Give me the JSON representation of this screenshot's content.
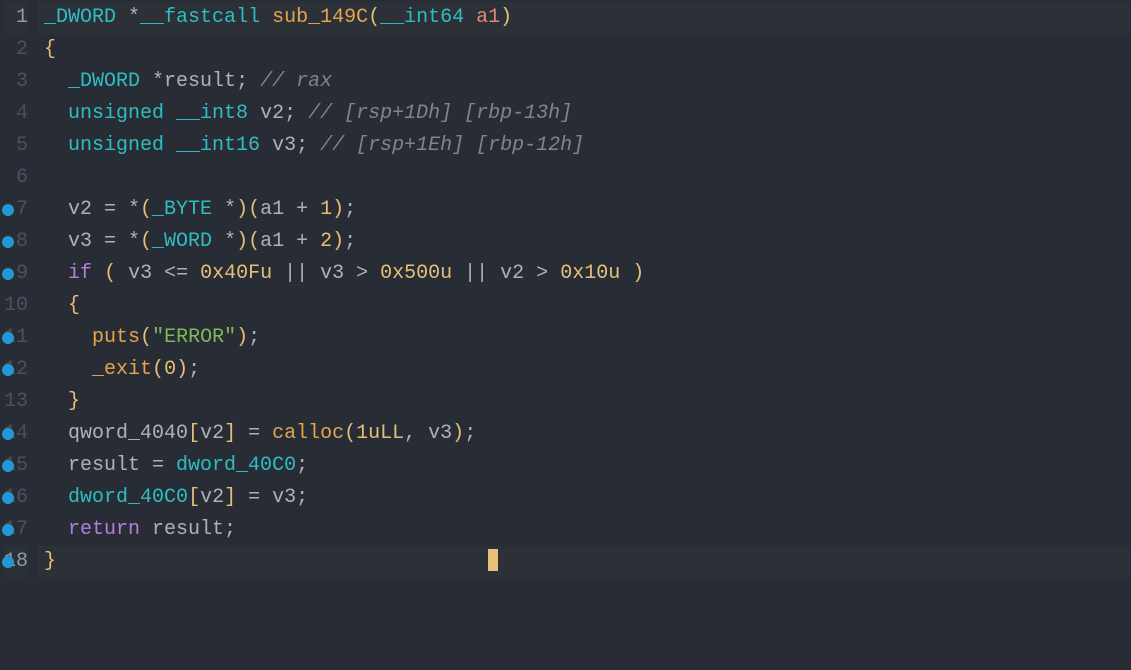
{
  "editor": {
    "cursor_line": 18,
    "lines": [
      {
        "num": 1,
        "bp": false,
        "hl": true,
        "tokens": [
          {
            "c": "tk-type",
            "t": "_DWORD"
          },
          {
            "c": "tk-ident",
            "t": " *"
          },
          {
            "c": "tk-type",
            "t": "__fastcall"
          },
          {
            "c": "tk-ident",
            "t": " "
          },
          {
            "c": "tk-func",
            "t": "sub_149C"
          },
          {
            "c": "tk-paren",
            "t": "("
          },
          {
            "c": "tk-type",
            "t": "__int64"
          },
          {
            "c": "tk-ident",
            "t": " "
          },
          {
            "c": "tk-global",
            "t": "a1"
          },
          {
            "c": "tk-paren",
            "t": ")"
          }
        ]
      },
      {
        "num": 2,
        "bp": false,
        "hl": false,
        "tokens": [
          {
            "c": "tk-paren",
            "t": "{"
          }
        ]
      },
      {
        "num": 3,
        "bp": false,
        "hl": false,
        "tokens": [
          {
            "c": "tk-ident",
            "t": "  "
          },
          {
            "c": "tk-type",
            "t": "_DWORD"
          },
          {
            "c": "tk-ident",
            "t": " *result; "
          },
          {
            "c": "tk-comment",
            "t": "// rax"
          }
        ]
      },
      {
        "num": 4,
        "bp": false,
        "hl": false,
        "tokens": [
          {
            "c": "tk-ident",
            "t": "  "
          },
          {
            "c": "tk-type",
            "t": "unsigned __int8"
          },
          {
            "c": "tk-ident",
            "t": " v2; "
          },
          {
            "c": "tk-comment",
            "t": "// [rsp+1Dh] [rbp-13h]"
          }
        ]
      },
      {
        "num": 5,
        "bp": false,
        "hl": false,
        "tokens": [
          {
            "c": "tk-ident",
            "t": "  "
          },
          {
            "c": "tk-type",
            "t": "unsigned __int16"
          },
          {
            "c": "tk-ident",
            "t": " v3; "
          },
          {
            "c": "tk-comment",
            "t": "// [rsp+1Eh] [rbp-12h]"
          }
        ]
      },
      {
        "num": 6,
        "bp": false,
        "hl": false,
        "tokens": [
          {
            "c": "tk-ident",
            "t": ""
          }
        ]
      },
      {
        "num": 7,
        "bp": true,
        "hl": false,
        "tokens": [
          {
            "c": "tk-ident",
            "t": "  v2 = *"
          },
          {
            "c": "tk-paren",
            "t": "("
          },
          {
            "c": "tk-type",
            "t": "_BYTE"
          },
          {
            "c": "tk-ident",
            "t": " *"
          },
          {
            "c": "tk-paren",
            "t": ")"
          },
          {
            "c": "tk-paren",
            "t": "("
          },
          {
            "c": "tk-ident",
            "t": "a1 + "
          },
          {
            "c": "tk-num",
            "t": "1"
          },
          {
            "c": "tk-paren",
            "t": ")"
          },
          {
            "c": "tk-ident",
            "t": ";"
          }
        ]
      },
      {
        "num": 8,
        "bp": true,
        "hl": false,
        "tokens": [
          {
            "c": "tk-ident",
            "t": "  v3 = *"
          },
          {
            "c": "tk-paren",
            "t": "("
          },
          {
            "c": "tk-type",
            "t": "_WORD"
          },
          {
            "c": "tk-ident",
            "t": " *"
          },
          {
            "c": "tk-paren",
            "t": ")"
          },
          {
            "c": "tk-paren",
            "t": "("
          },
          {
            "c": "tk-ident",
            "t": "a1 + "
          },
          {
            "c": "tk-num",
            "t": "2"
          },
          {
            "c": "tk-paren",
            "t": ")"
          },
          {
            "c": "tk-ident",
            "t": ";"
          }
        ]
      },
      {
        "num": 9,
        "bp": true,
        "hl": false,
        "tokens": [
          {
            "c": "tk-ident",
            "t": "  "
          },
          {
            "c": "tk-kw",
            "t": "if"
          },
          {
            "c": "tk-ident",
            "t": " "
          },
          {
            "c": "tk-paren",
            "t": "("
          },
          {
            "c": "tk-ident",
            "t": " v3 <= "
          },
          {
            "c": "tk-num",
            "t": "0x40Fu"
          },
          {
            "c": "tk-ident",
            "t": " || v3 > "
          },
          {
            "c": "tk-num",
            "t": "0x500u"
          },
          {
            "c": "tk-ident",
            "t": " || v2 > "
          },
          {
            "c": "tk-num",
            "t": "0x10u"
          },
          {
            "c": "tk-ident",
            "t": " "
          },
          {
            "c": "tk-paren",
            "t": ")"
          }
        ]
      },
      {
        "num": 10,
        "bp": false,
        "hl": false,
        "tokens": [
          {
            "c": "tk-ident",
            "t": "  "
          },
          {
            "c": "tk-paren",
            "t": "{"
          }
        ]
      },
      {
        "num": 11,
        "bp": true,
        "hl": false,
        "tokens": [
          {
            "c": "tk-ident",
            "t": "    "
          },
          {
            "c": "tk-func",
            "t": "puts"
          },
          {
            "c": "tk-paren",
            "t": "("
          },
          {
            "c": "tk-str",
            "t": "\"ERROR\""
          },
          {
            "c": "tk-paren",
            "t": ")"
          },
          {
            "c": "tk-ident",
            "t": ";"
          }
        ]
      },
      {
        "num": 12,
        "bp": true,
        "hl": false,
        "tokens": [
          {
            "c": "tk-ident",
            "t": "    "
          },
          {
            "c": "tk-func",
            "t": "_exit"
          },
          {
            "c": "tk-paren",
            "t": "("
          },
          {
            "c": "tk-num",
            "t": "0"
          },
          {
            "c": "tk-paren",
            "t": ")"
          },
          {
            "c": "tk-ident",
            "t": ";"
          }
        ]
      },
      {
        "num": 13,
        "bp": false,
        "hl": false,
        "tokens": [
          {
            "c": "tk-ident",
            "t": "  "
          },
          {
            "c": "tk-paren",
            "t": "}"
          }
        ]
      },
      {
        "num": 14,
        "bp": true,
        "hl": false,
        "tokens": [
          {
            "c": "tk-ident",
            "t": "  qword_4040"
          },
          {
            "c": "tk-paren",
            "t": "["
          },
          {
            "c": "tk-ident",
            "t": "v2"
          },
          {
            "c": "tk-paren",
            "t": "]"
          },
          {
            "c": "tk-ident",
            "t": " = "
          },
          {
            "c": "tk-func",
            "t": "calloc"
          },
          {
            "c": "tk-paren",
            "t": "("
          },
          {
            "c": "tk-num",
            "t": "1uLL"
          },
          {
            "c": "tk-ident",
            "t": ", v3"
          },
          {
            "c": "tk-paren",
            "t": ")"
          },
          {
            "c": "tk-ident",
            "t": ";"
          }
        ]
      },
      {
        "num": 15,
        "bp": true,
        "hl": false,
        "tokens": [
          {
            "c": "tk-ident",
            "t": "  result = "
          },
          {
            "c": "tk-type",
            "t": "dword_40C0"
          },
          {
            "c": "tk-ident",
            "t": ";"
          }
        ]
      },
      {
        "num": 16,
        "bp": true,
        "hl": false,
        "tokens": [
          {
            "c": "tk-ident",
            "t": "  "
          },
          {
            "c": "tk-type",
            "t": "dword_40C0"
          },
          {
            "c": "tk-paren",
            "t": "["
          },
          {
            "c": "tk-ident",
            "t": "v2"
          },
          {
            "c": "tk-paren",
            "t": "]"
          },
          {
            "c": "tk-ident",
            "t": " = v3;"
          }
        ]
      },
      {
        "num": 17,
        "bp": true,
        "hl": false,
        "tokens": [
          {
            "c": "tk-ident",
            "t": "  "
          },
          {
            "c": "tk-kw",
            "t": "return"
          },
          {
            "c": "tk-ident",
            "t": " result;"
          }
        ]
      },
      {
        "num": 18,
        "bp": true,
        "hl": true,
        "tokens": [
          {
            "c": "tk-paren",
            "t": "}"
          }
        ]
      }
    ]
  }
}
